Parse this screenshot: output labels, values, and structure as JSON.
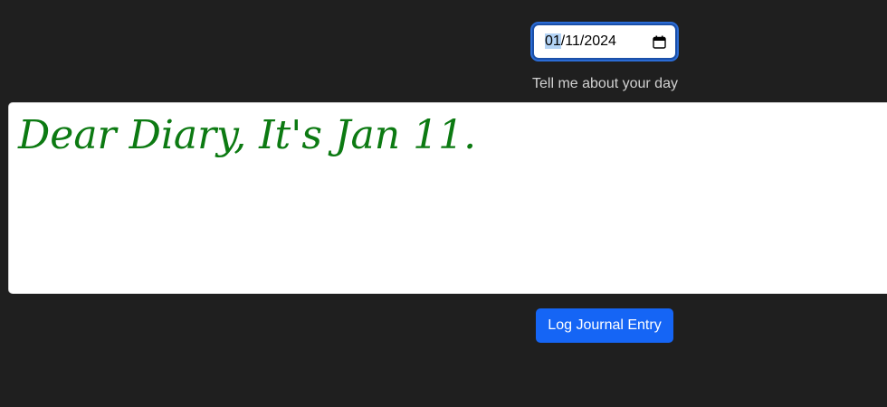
{
  "date_input": {
    "month": "01",
    "separator_1": "/",
    "day": "11",
    "separator_2": "/",
    "year": "2024",
    "icon": "calendar-icon"
  },
  "prompt_label": "Tell me about your day",
  "journal": {
    "text": "Dear Diary, It's Jan 11."
  },
  "log_button_label": "Log Journal Entry",
  "colors": {
    "background": "#1f1f1f",
    "journal_text": "#0c7a12",
    "button": "#1565f5",
    "focus_ring": "#2b6cd6"
  }
}
